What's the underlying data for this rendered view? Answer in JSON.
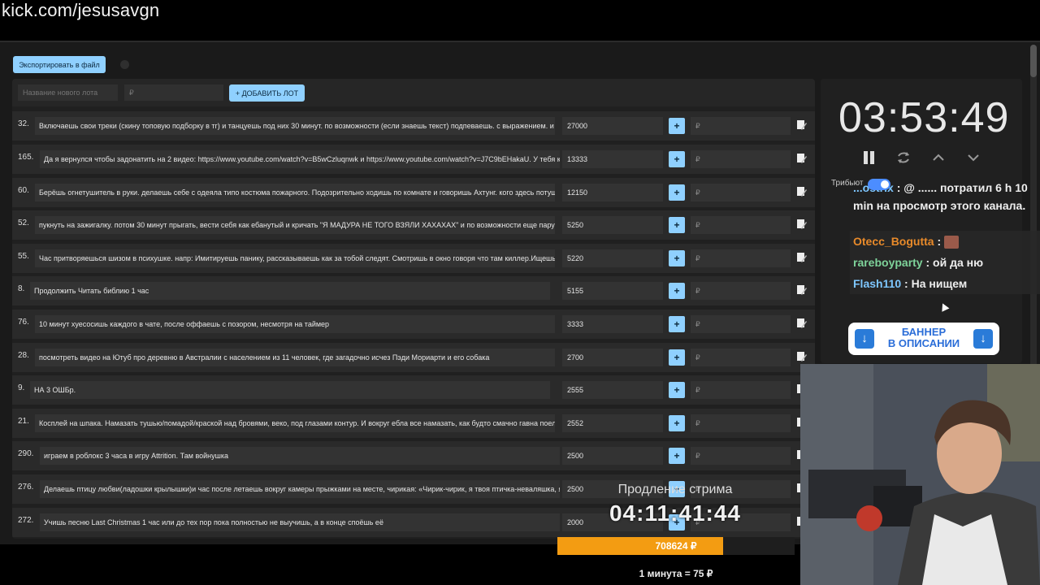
{
  "url": "kick.com/jesusavgn",
  "toolbar": {
    "export_label": "Экспортировать в файл"
  },
  "add_lot": {
    "name_placeholder": "Название нового лота",
    "amount_placeholder": "₽",
    "button_label": "+ ДОБАВИТЬ ЛОТ"
  },
  "lots": [
    {
      "idx": "32.",
      "title": "Включаешь свои треки (скину топовую подборку в тг) и танцуешь под них 30 минут. по возможности (если знаешь текст) подпеваешь. с выражением. и и",
      "amount": "27000"
    },
    {
      "idx": "165.",
      "title": "Да я вернулся чтобы задонатить на 2 видео: https://www.youtube.com/watch?v=B5wCzluqnwk и https://www.youtube.com/watch?v=J7C9bEHakaU. У тебя к",
      "amount": "13333"
    },
    {
      "idx": "60.",
      "title": "Берёшь огнетушитель в руки. делаешь себе с одеяла типо костюма пожарного. Подозрительно ходишь по комнате и говоришь Ахтунг. кого здесь потуш",
      "amount": "12150"
    },
    {
      "idx": "52.",
      "title": "пукнуть на зажигалку. потом 30 минут прыгать, вести себя как ебанутый и кричать \"Я МАДУРА НЕ ТОГО ВЗЯЛИ ХАХАХАХ\" и по возможности еще пару р",
      "amount": "5250"
    },
    {
      "idx": "55.",
      "title": "Час притворяешься шизом в психушке. напр: Имитируешь панику, рассказываешь как за тобой следят. Смотришь в окно говоря что там киллер.Ищешь с",
      "amount": "5220"
    },
    {
      "idx": "8.",
      "title": "Продолжить Читать библию 1 час",
      "amount": "5155"
    },
    {
      "idx": "76.",
      "title": "10 минут хуесосишь каждого в чате, после оффаешь с позором, несмотря на таймер",
      "amount": "3333"
    },
    {
      "idx": "28.",
      "title": "посмотреть видео на Ютуб про деревню в Австралии с населением из 11 человек, где загадочно исчез Пэди Мориарти и его собака",
      "amount": "2700"
    },
    {
      "idx": "9.",
      "title": "НА 3 ОШБр.",
      "amount": "2555"
    },
    {
      "idx": "21.",
      "title": "Косплей на шпака. Намазать тушью/помадой/краской над бровями, веко, под глазами контур. И вокруг ебла все намазать, как будто смачно гавна поел.",
      "amount": "2552"
    },
    {
      "idx": "290.",
      "title": "играем в роблокс 3 часа в игру Attrition. Там войнушка",
      "amount": "2500"
    },
    {
      "idx": "276.",
      "title": "Делаешь птицу любви(ладошки крылышки)и час после летаешь вокруг камеры прыжками на месте, чирикая: «Чирик-чирик, я твоя птичка-неваляшка, я",
      "amount": "2500"
    },
    {
      "idx": "272.",
      "title": "Учишь песню Last Christmas 1 час или до тех пор пока полностью не выучишь, а в конце споёшь её",
      "amount": "2000"
    }
  ],
  "lot_row": {
    "plus_label": "+",
    "rub_placeholder": "₽"
  },
  "timer": {
    "value": "03:53:49"
  },
  "tribute": {
    "label": "Трибьют",
    "enabled": true
  },
  "chat": {
    "messages": [
      {
        "user": "...ostrix",
        "user_color": "#7ec7ff",
        "text": ": @ ...... потратил 6 h 10 min на просмотр этого канала."
      },
      {
        "user": "Otecc_Bogutta",
        "user_color": "#e88a2a",
        "text": ":"
      },
      {
        "user": "rareboyparty",
        "user_color": "#7ed39a",
        "text": ": ой да ню"
      },
      {
        "user": "Flash110",
        "user_color": "#7ec7ff",
        "text": ": На нищем"
      }
    ]
  },
  "banner": {
    "line1": "БАННЕР",
    "line2": "В ОПИСАНИИ"
  },
  "extension": {
    "title": "Продление стрима",
    "time": "04:11:41:44",
    "amount": "708624 ₽",
    "progress": 0.7,
    "rate": "1 минута = 75 ₽"
  },
  "colors": {
    "accent": "#8fd0ff",
    "progress": "#f39c12",
    "banner_blue": "#2a7bd8"
  }
}
